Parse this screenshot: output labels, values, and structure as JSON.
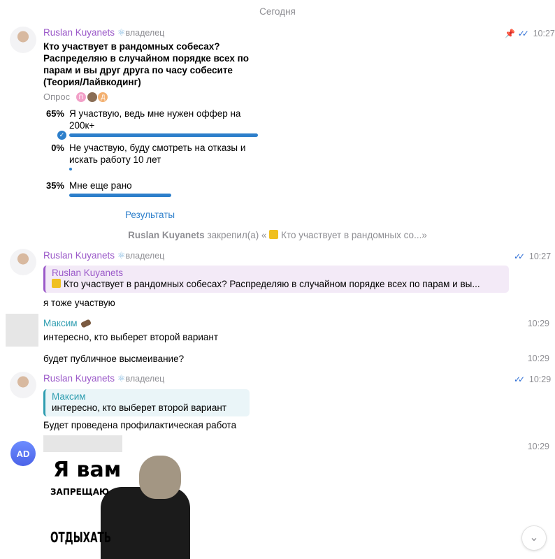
{
  "date_separator": "Сегодня",
  "messages": {
    "poll_msg": {
      "sender": "Ruslan Kuyanets",
      "role": "владелец",
      "time": "10:27",
      "question": "Кто участвует в рандомных собесах? Распределяю в случайном порядке всех по парам и вы друг друга по часу собесите (Теория/Лайвкодинг)",
      "poll_label": "Опрос",
      "voter_initials": [
        "П",
        "Д"
      ],
      "options": [
        {
          "percent": "65%",
          "text": "Я участвую, ведь мне нужен оффер на 200к+",
          "fraction": 0.65,
          "chosen": true
        },
        {
          "percent": "0%",
          "text": "Не участвую, буду смотреть на отказы и искать работу 10 лет",
          "fraction": 0.0,
          "chosen": false
        },
        {
          "percent": "35%",
          "text": "Мне еще рано",
          "fraction": 0.35,
          "chosen": false
        }
      ],
      "results_label": "Результаты"
    },
    "service_pin": {
      "actor": "Ruslan Kuyanets",
      "action": "закрепил(а) «",
      "snippet": "Кто участвует в рандомных со...»"
    },
    "reply_msg_1": {
      "sender": "Ruslan Kuyanets",
      "role": "владелец",
      "time": "10:27",
      "quote_name": "Ruslan Kuyanets",
      "quote_text": "Кто участвует в рандомных собесах? Распределяю в случайном порядке всех по парам и вы...",
      "text": "я тоже участвую"
    },
    "maxim_msg_1": {
      "sender": "Максим",
      "time": "10:29",
      "text": "интересно, кто выберет второй вариант"
    },
    "maxim_msg_2": {
      "time": "10:29",
      "text": "будет публичное высмеивание?"
    },
    "reply_msg_2": {
      "sender": "Ruslan Kuyanets",
      "role": "владелец",
      "time": "10:29",
      "quote_name": "Максим",
      "quote_text": "интересно, кто выберет второй вариант",
      "text": "Будет проведена профилактическая работа"
    },
    "sticker_msg": {
      "avatar_initials": "AD",
      "time": "10:29",
      "sticker_line1": "Я вам",
      "sticker_line2": "ЗАПРЕЩАЮ",
      "sticker_line3": "ОТДЫХАТЬ"
    }
  },
  "icons": {
    "pin": "pin-icon",
    "read_checks": "double-check-icon",
    "react_badge": "atom-icon",
    "poll_chart": "bar-chart-icon",
    "scroll_down": "chevron-down-icon"
  },
  "colors": {
    "accent_blue": "#2d7fcb",
    "sender_purple": "#9b59c9",
    "sender_teal": "#2e9db0",
    "meta_gray": "#8e8e93"
  }
}
